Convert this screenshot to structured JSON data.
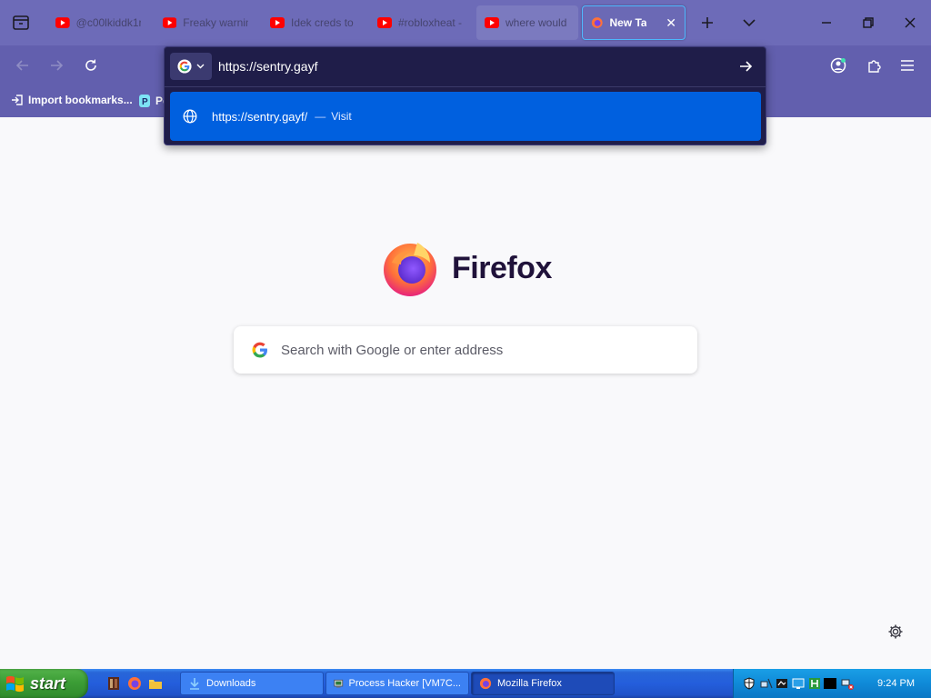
{
  "browser": {
    "tabs": [
      {
        "title": "@c00lkiddk1r",
        "icon": "youtube-icon",
        "active": false
      },
      {
        "title": "Freaky warnin",
        "icon": "youtube-icon",
        "active": false
      },
      {
        "title": "Idek creds to",
        "icon": "youtube-icon",
        "active": false
      },
      {
        "title": "#robloxheat -",
        "icon": "youtube-icon",
        "active": false
      },
      {
        "title": "where would",
        "icon": "youtube-icon",
        "active": false
      },
      {
        "title": "New Tab",
        "icon": "firefox-icon",
        "active": true
      }
    ],
    "urlbar": {
      "value": "https://sentry.gayf",
      "engine_icon": "google-icon"
    },
    "suggestion": {
      "url": "https://sentry.gayf/",
      "dash": "—",
      "action": "Visit"
    },
    "bookmarks": [
      {
        "label": "Import bookmarks...",
        "icon": "import-icon"
      },
      {
        "label": "Pe",
        "icon": "bookmark-p-icon"
      }
    ]
  },
  "content": {
    "brand": "Firefox",
    "search_placeholder": "Search with Google or enter address"
  },
  "taskbar": {
    "start_label": "start",
    "tasks": [
      {
        "label": "Downloads",
        "icon": "downloads-icon",
        "active": false
      },
      {
        "label": "Process Hacker [VM7C...",
        "icon": "process-hacker-icon",
        "active": false
      },
      {
        "label": "Mozilla Firefox",
        "icon": "firefox-icon",
        "active": true
      }
    ],
    "clock": "9:24 PM"
  },
  "colors": {
    "tabstrip": "#6d6bb8",
    "toolbar": "#625fae",
    "popup": "#1f1d49",
    "suggest_highlight": "#0060df",
    "page_bg": "#f9f9fb"
  }
}
